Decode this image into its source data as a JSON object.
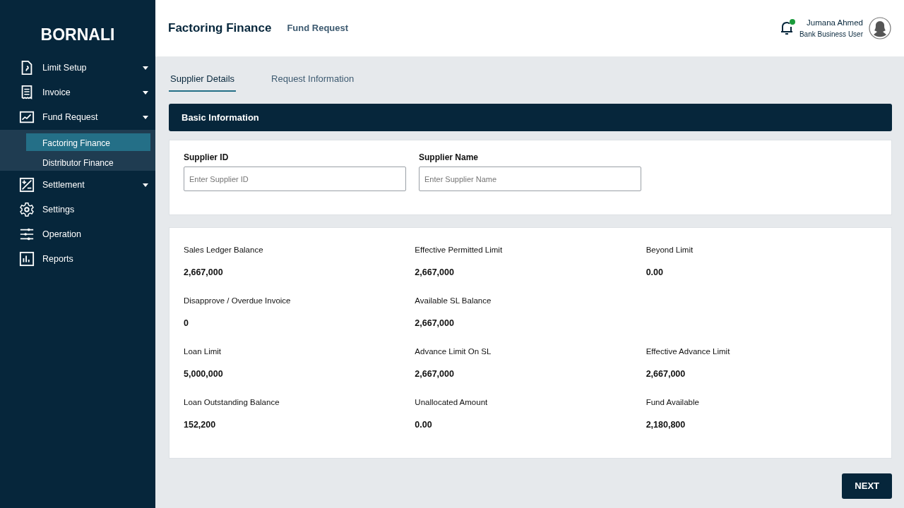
{
  "sidebar": {
    "brand": "BORNALI",
    "items": [
      {
        "label": "Limit Setup",
        "has_caret": true
      },
      {
        "label": "Invoice",
        "has_caret": true
      },
      {
        "label": "Fund Request",
        "has_caret": true,
        "children": [
          {
            "label": "Factoring Finance",
            "selected": true
          },
          {
            "label": "Distributor Finance",
            "selected": false
          }
        ]
      },
      {
        "label": "Settlement",
        "has_caret": true
      },
      {
        "label": "Settings"
      },
      {
        "label": "Operation"
      },
      {
        "label": "Reports"
      }
    ]
  },
  "header": {
    "title": "Factoring Finance",
    "subtitle": "Fund Request",
    "notification_dot": true,
    "user_name": "Jumana Ahmed",
    "user_role": "Bank Business User"
  },
  "tabs": [
    {
      "label": "Supplier Details",
      "selected": true
    },
    {
      "label": "Request Information",
      "selected": false
    }
  ],
  "section_title": "Basic Information",
  "fields": [
    {
      "label": "Supplier ID",
      "placeholder": "Enter Supplier ID"
    },
    {
      "label": "Supplier Name",
      "placeholder": "Enter Supplier Name"
    }
  ],
  "summary": [
    [
      {
        "label": "Sales Ledger Balance",
        "value": "2,667,000"
      },
      {
        "label": "Effective Permitted Limit",
        "value": "2,667,000"
      },
      {
        "label": "Beyond Limit",
        "value": "0.00"
      }
    ],
    [
      {
        "label": "Disapprove / Overdue Invoice",
        "value": "0"
      },
      {
        "label": "Available SL Balance",
        "value": "2,667,000"
      }
    ],
    [
      {
        "label": "Loan Limit",
        "value": "5,000,000"
      },
      {
        "label": "Advance Limit On SL",
        "value": "2,667,000"
      },
      {
        "label": "Effective Advance Limit",
        "value": "2,667,000"
      }
    ],
    [
      {
        "label": "Loan Outstanding Balance",
        "value": "152,200"
      },
      {
        "label": "Unallocated Amount",
        "value": "0.00"
      },
      {
        "label": "Fund Available",
        "value": "2,180,800"
      }
    ]
  ],
  "next_button": "NEXT"
}
